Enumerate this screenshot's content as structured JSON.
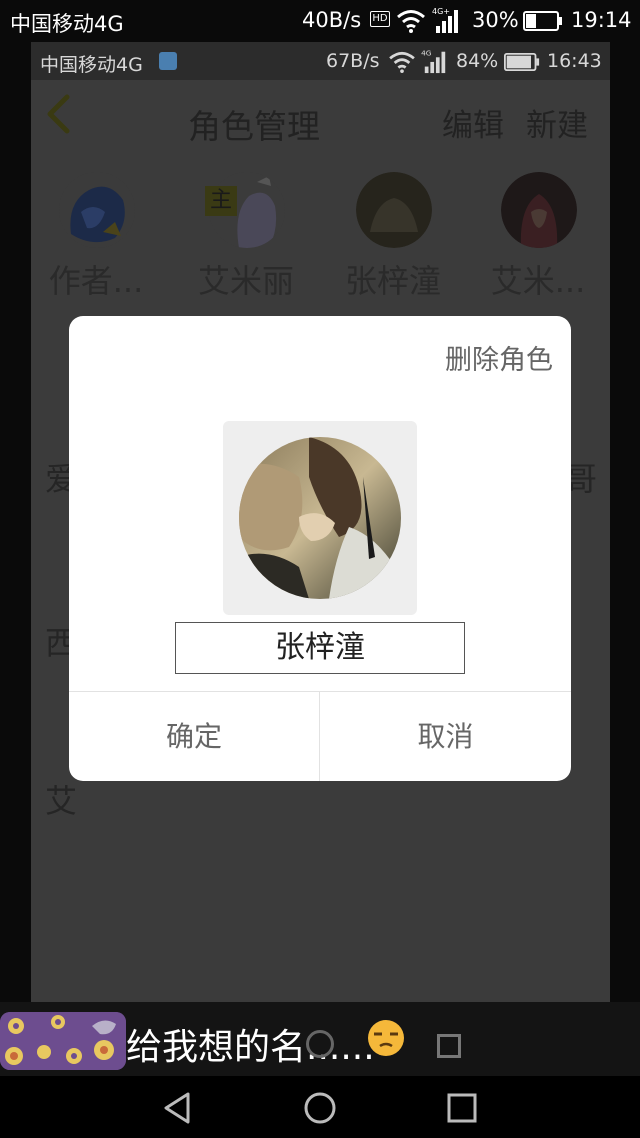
{
  "outer_status": {
    "carrier": "中国移动4G",
    "speed": "40B/s",
    "battery": "30%",
    "time": "19:14"
  },
  "inner_status": {
    "carrier": "中国移动4G",
    "speed": "67B/s",
    "battery": "84%",
    "time": "16:43"
  },
  "header": {
    "title": "角色管理",
    "edit": "编辑",
    "new": "新建"
  },
  "roles": [
    {
      "name": "作者..."
    },
    {
      "name": "艾米丽",
      "badge": "主"
    },
    {
      "name": "张梓潼"
    },
    {
      "name": "艾米..."
    }
  ],
  "partial_names": {
    "r2_left": "爱",
    "r2_right": "哥",
    "r3_left": "西",
    "r4_left": "艾"
  },
  "dialog": {
    "delete_label": "删除角色",
    "name_value": "张梓潼",
    "confirm": "确定",
    "cancel": "取消"
  },
  "chat": {
    "message": "给我想的名......"
  },
  "colors": {
    "dim_overlay": "#3b3b3b",
    "dialog_bg": "#ffffff",
    "header_accent": "#3a3a12"
  }
}
